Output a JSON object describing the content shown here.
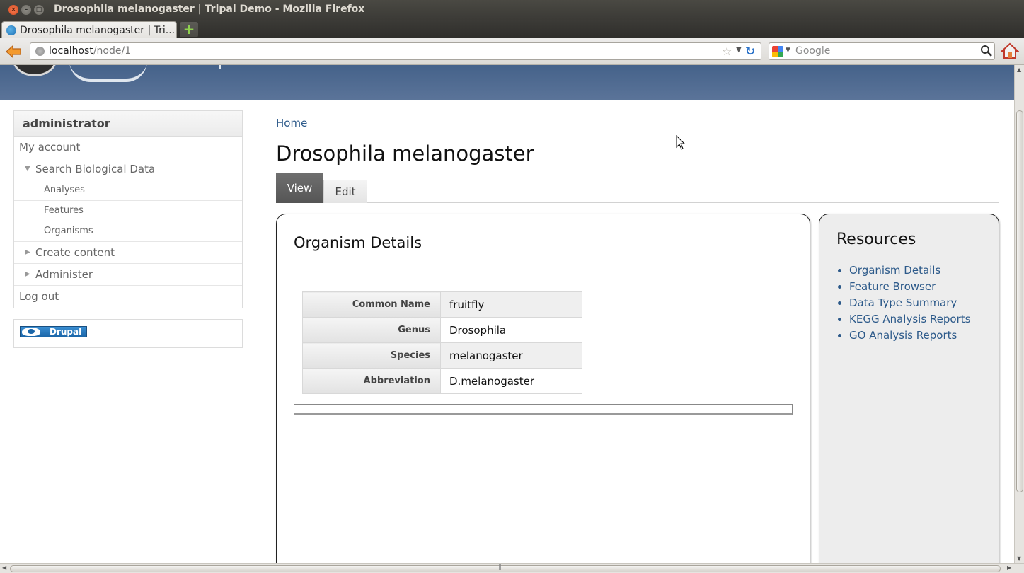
{
  "window": {
    "title": "Drosophila melanogaster | Tripal Demo - Mozilla Firefox"
  },
  "browser": {
    "tab_label": "Drosophila melanogaster | Tri...",
    "url_host": "localhost",
    "url_path": "/node/1",
    "search_placeholder": "Google",
    "icons": [
      "back-icon",
      "star-icon",
      "reload-icon",
      "google-icon",
      "magnifier-icon",
      "home-icon"
    ]
  },
  "sidebar": {
    "title": "administrator",
    "items": [
      {
        "label": "My account"
      },
      {
        "label": "Search Biological Data",
        "expanded": true
      },
      {
        "label": "Analyses"
      },
      {
        "label": "Features"
      },
      {
        "label": "Organisms"
      },
      {
        "label": "Create content",
        "expanded": false
      },
      {
        "label": "Administer",
        "expanded": false
      },
      {
        "label": "Log out"
      }
    ],
    "badge": "Drupal"
  },
  "main": {
    "breadcrumb": "Home",
    "title": "Drosophila melanogaster",
    "tabs": [
      {
        "label": "View",
        "active": true
      },
      {
        "label": "Edit",
        "active": false
      }
    ],
    "details": {
      "title": "Organism Details",
      "rows": [
        {
          "label": "Common Name",
          "value": "fruitfly"
        },
        {
          "label": "Genus",
          "value": "Drosophila"
        },
        {
          "label": "Species",
          "value": "melanogaster"
        },
        {
          "label": "Abbreviation",
          "value": "D.melanogaster"
        }
      ]
    },
    "resources": {
      "title": "Resources",
      "links": [
        {
          "label": "Organism Details"
        },
        {
          "label": "Feature Browser"
        },
        {
          "label": "Data Type Summary"
        },
        {
          "label": "KEGG Analysis Reports"
        },
        {
          "label": "GO Analysis Reports"
        }
      ]
    }
  },
  "colors": {
    "header": "#516c93",
    "link": "#2d5a8a",
    "active_tab": "#606060"
  }
}
